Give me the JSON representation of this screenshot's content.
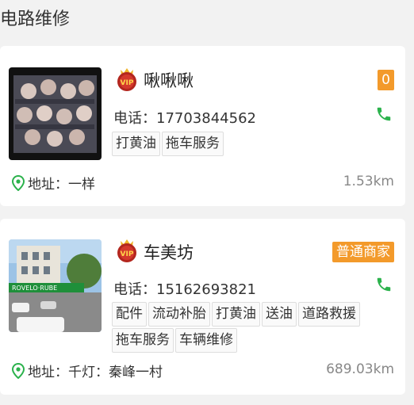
{
  "section_title": "电路维修",
  "shops": [
    {
      "name": "啾啾啾",
      "badge": "0",
      "phone": "电话：17703844562",
      "tags": [
        "打黄油",
        "拖车服务"
      ],
      "address": "地址：一样",
      "distance": "1.53km"
    },
    {
      "name": "车美坊",
      "badge": "普通商家",
      "phone": "电话：15162693821",
      "tags": [
        "配件",
        "流动补胎",
        "打黄油",
        "送油",
        "道路救援",
        "拖车服务",
        "车辆维修"
      ],
      "address": "地址：千灯：秦峰一村",
      "distance": "689.03km"
    }
  ],
  "colors": {
    "badge": "#f39a2b",
    "phone_icon": "#2bb24c",
    "pin": "#2bb24c"
  }
}
